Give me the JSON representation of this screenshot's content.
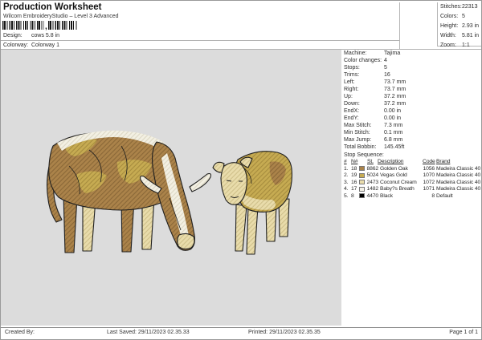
{
  "header": {
    "title": "Production Worksheet",
    "subtitle": "Wilcom EmbroideryStudio – Level 3 Advanced",
    "design_label": "Design:",
    "design_value": "cows 5.8 in",
    "colorway_label": "Colorway:",
    "colorway_value": "Colorway 1"
  },
  "stats": {
    "items": [
      {
        "label": "Stitches:",
        "value": "22313"
      },
      {
        "label": "Colors:",
        "value": "5"
      },
      {
        "label": "Height:",
        "value": "2.93 in"
      },
      {
        "label": "Width:",
        "value": "5.81 in"
      },
      {
        "label": "Zoom:",
        "value": "1:1"
      }
    ]
  },
  "machine": {
    "items": [
      {
        "label": "Machine:",
        "value": "Tajima"
      },
      {
        "label": "Color changes:",
        "value": "4"
      },
      {
        "label": "Stops:",
        "value": "5"
      },
      {
        "label": "Trims:",
        "value": "16"
      },
      {
        "label": "Left:",
        "value": "73.7 mm"
      },
      {
        "label": "Right:",
        "value": "73.7 mm"
      },
      {
        "label": "Up:",
        "value": "37.2 mm"
      },
      {
        "label": "Down:",
        "value": "37.2 mm"
      },
      {
        "label": "EndX:",
        "value": "0.00 in"
      },
      {
        "label": "EndY:",
        "value": "0.00 in"
      },
      {
        "label": "Max Stitch:",
        "value": "7.3 mm"
      },
      {
        "label": "Min Stitch:",
        "value": "0.1 mm"
      },
      {
        "label": "Max Jump:",
        "value": "6.8 mm"
      },
      {
        "label": "Total Bobbin:",
        "value": "145.45ft"
      }
    ]
  },
  "stop_sequence": {
    "title": "Stop Sequence:",
    "columns": {
      "idx": "#",
      "n": "N#",
      "st": "St.",
      "description": "Description",
      "code": "Code",
      "brand": "Brand"
    },
    "rows": [
      {
        "idx": "1.",
        "n": "18",
        "color": "#a9824a",
        "st": "8862",
        "description": "Golden Oak",
        "code": "1056",
        "brand": "Madeira Classic 40"
      },
      {
        "idx": "2.",
        "n": "19",
        "color": "#c6ab52",
        "st": "5024",
        "description": "Vegas Gold",
        "code": "1070",
        "brand": "Madeira Classic 40"
      },
      {
        "idx": "3.",
        "n": "16",
        "color": "#e9dcab",
        "st": "2473",
        "description": "Coconut Cream",
        "code": "1072",
        "brand": "Madeira Classic 40"
      },
      {
        "idx": "4.",
        "n": "17",
        "color": "#f4f1e6",
        "st": "1482",
        "description": "Baby?s Breath",
        "code": "1071",
        "brand": "Madeira Classic 40"
      },
      {
        "idx": "5.",
        "n": "8",
        "color": "#000000",
        "st": "4470",
        "description": "Black",
        "code": "8",
        "brand": "Default"
      }
    ]
  },
  "design_preview": {
    "description": "embroidery of a grazing longhorn cow with a calf",
    "background": "#dcdcdc",
    "palette": {
      "golden_oak": "#ab834a",
      "vegas_gold": "#c6ab52",
      "coconut_cream": "#e9dcab",
      "babys_breath": "#f3f0e3",
      "outline_black": "#1f1f1f"
    }
  },
  "footer": {
    "created_by": "Created By:",
    "last_saved": "Last Saved: 29/11/2023 02.35.33",
    "printed": "Printed: 29/11/2023 02.35.35",
    "page": "Page 1 of 1"
  }
}
